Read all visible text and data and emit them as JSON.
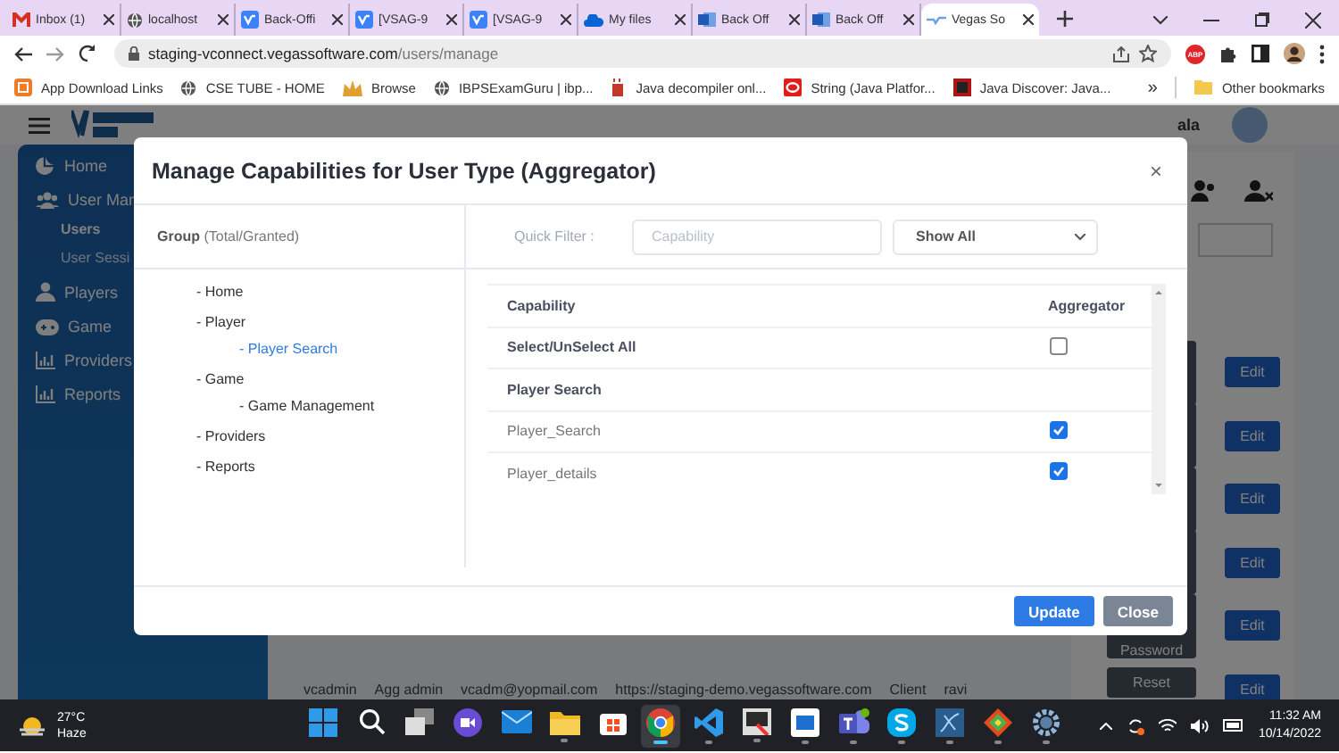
{
  "browser": {
    "tabs": [
      {
        "title": "Inbox (1)",
        "kind": "mail",
        "selected": false
      },
      {
        "title": "localhost",
        "kind": "globe",
        "selected": false
      },
      {
        "title": "Back-Offi",
        "kind": "vs",
        "selected": false
      },
      {
        "title": "[VSAG-9",
        "kind": "vs",
        "selected": false
      },
      {
        "title": "[VSAG-9",
        "kind": "vs",
        "selected": false
      },
      {
        "title": "My files",
        "kind": "cloud",
        "selected": false
      },
      {
        "title": "Back Off",
        "kind": "doc",
        "selected": false
      },
      {
        "title": "Back Off",
        "kind": "doc",
        "selected": false
      },
      {
        "title": "Vegas So",
        "kind": "vegas",
        "selected": true
      }
    ],
    "url": {
      "host": "staging-vconnect.vegassoftware.com",
      "path": "/users/manage"
    },
    "extension_badge": "ABP",
    "bookmarks": [
      {
        "label": "App Download Links",
        "kind": "apps"
      },
      {
        "label": "CSE TUBE - HOME",
        "kind": "globe"
      },
      {
        "label": "Browse",
        "kind": "crown"
      },
      {
        "label": "IBPSExamGuru | ibp...",
        "kind": "globe"
      },
      {
        "label": "Java decompiler onl...",
        "kind": "cup"
      },
      {
        "label": "String (Java Platfor...",
        "kind": "ring"
      },
      {
        "label": "Java Discover: Java...",
        "kind": "square"
      }
    ],
    "more_bookmarks": "»",
    "other_bookmarks": "Other bookmarks"
  },
  "app": {
    "user_name": "ala",
    "sidebar": [
      {
        "label": "Home",
        "kind": "home"
      },
      {
        "label": "User Man",
        "kind": "users",
        "children": [
          {
            "label": "Users",
            "selected": true
          },
          {
            "label": "User Sessi",
            "selected": false
          }
        ]
      },
      {
        "label": "Players",
        "kind": "player"
      },
      {
        "label": "Game",
        "kind": "game"
      },
      {
        "label": "Providers",
        "kind": "chart"
      },
      {
        "label": "Reports",
        "kind": "chart"
      }
    ],
    "action_rows": [
      {
        "secondary": "",
        "edit": "Edit"
      },
      {
        "secondary": "",
        "edit": "Edit"
      },
      {
        "secondary": "",
        "edit": "Edit"
      },
      {
        "secondary": "",
        "edit": "Edit"
      },
      {
        "secondary": "Password",
        "edit": "Edit"
      },
      {
        "secondary": "Reset",
        "edit": "Edit",
        "kind": "short"
      }
    ],
    "row": [
      "vcadmin",
      "Agg admin",
      "vcadm@yopmail.com",
      "https://staging-demo.vegassoftware.com",
      "Client",
      "ravi"
    ]
  },
  "modal": {
    "title": "Manage Capabilities for User Type (Aggregator)",
    "close": "×",
    "group_header": "**Group** (Total/Granted)",
    "groups": [
      {
        "label": "- Home",
        "selected": false
      },
      {
        "label": "- Player",
        "selected": false,
        "children": [
          {
            "label": "- Player Search",
            "selected": true
          }
        ]
      },
      {
        "label": "- Game",
        "selected": false,
        "children": [
          {
            "label": "- Game Management",
            "selected": false
          }
        ]
      },
      {
        "label": "- Providers",
        "selected": false
      },
      {
        "label": "- Reports",
        "selected": false
      }
    ],
    "filter_label": "Quick Filter :",
    "filter_placeholder": "Capability",
    "filter_select": "Show All",
    "columns": [
      "Capability",
      "Aggregator"
    ],
    "rows": [
      {
        "kind": "all",
        "label": "Select/UnSelect All",
        "checked": false
      },
      {
        "kind": "group",
        "label": "Player Search"
      },
      {
        "kind": "item",
        "label": "Player_Search",
        "checked": true
      },
      {
        "kind": "item",
        "label": "Player_details",
        "checked": true
      }
    ],
    "buttons": [
      {
        "label": "Update",
        "kind": "primary"
      },
      {
        "label": "Close",
        "kind": "secondary"
      }
    ]
  },
  "taskbar": {
    "temperature": "27°C",
    "weather": "Haze",
    "apps": [
      {
        "kind": "windows",
        "running": false,
        "selected": false
      },
      {
        "kind": "search",
        "running": false,
        "selected": false
      },
      {
        "kind": "taskview",
        "running": false,
        "selected": false
      },
      {
        "kind": "video",
        "running": false,
        "selected": false
      },
      {
        "kind": "mail",
        "running": false,
        "selected": false
      },
      {
        "kind": "folder",
        "running": true,
        "selected": false
      },
      {
        "kind": "store",
        "running": false,
        "selected": false
      },
      {
        "kind": "chrome",
        "running": true,
        "selected": true
      },
      {
        "kind": "code",
        "running": true,
        "selected": false
      },
      {
        "kind": "snip",
        "running": true,
        "selected": false
      },
      {
        "kind": "window",
        "running": true,
        "selected": false
      },
      {
        "kind": "teams",
        "running": true,
        "selected": false
      },
      {
        "kind": "skype",
        "running": true,
        "selected": false
      },
      {
        "kind": "database",
        "running": true,
        "selected": false
      },
      {
        "kind": "diamond",
        "running": true,
        "selected": false
      },
      {
        "kind": "gear",
        "running": true,
        "selected": false
      }
    ],
    "time": "11:32 AM",
    "date": "10/14/2022"
  }
}
